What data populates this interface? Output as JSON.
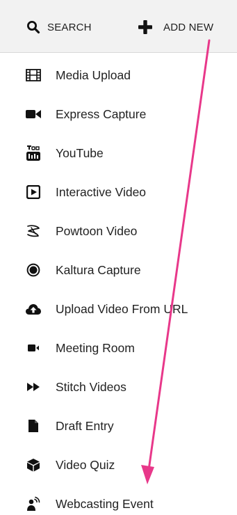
{
  "topbar": {
    "search_label": "SEARCH",
    "add_new_label": "ADD NEW"
  },
  "menu": {
    "items": [
      {
        "label": "Media Upload",
        "icon": "film-icon"
      },
      {
        "label": "Express Capture",
        "icon": "video-camera-icon"
      },
      {
        "label": "YouTube",
        "icon": "youtube-icon"
      },
      {
        "label": "Interactive Video",
        "icon": "play-square-icon"
      },
      {
        "label": "Powtoon Video",
        "icon": "powtoon-icon"
      },
      {
        "label": "Kaltura Capture",
        "icon": "record-icon"
      },
      {
        "label": "Upload Video From URL",
        "icon": "cloud-upload-icon"
      },
      {
        "label": "Meeting Room",
        "icon": "meeting-camera-icon"
      },
      {
        "label": "Stitch Videos",
        "icon": "fast-forward-icon"
      },
      {
        "label": "Draft Entry",
        "icon": "file-icon"
      },
      {
        "label": "Video Quiz",
        "icon": "cube-icon"
      },
      {
        "label": "Webcasting Event",
        "icon": "webcast-icon"
      }
    ]
  },
  "colors": {
    "arrow": "#e8388a",
    "icon": "#111111",
    "topbar_bg": "#f2f2f2"
  }
}
